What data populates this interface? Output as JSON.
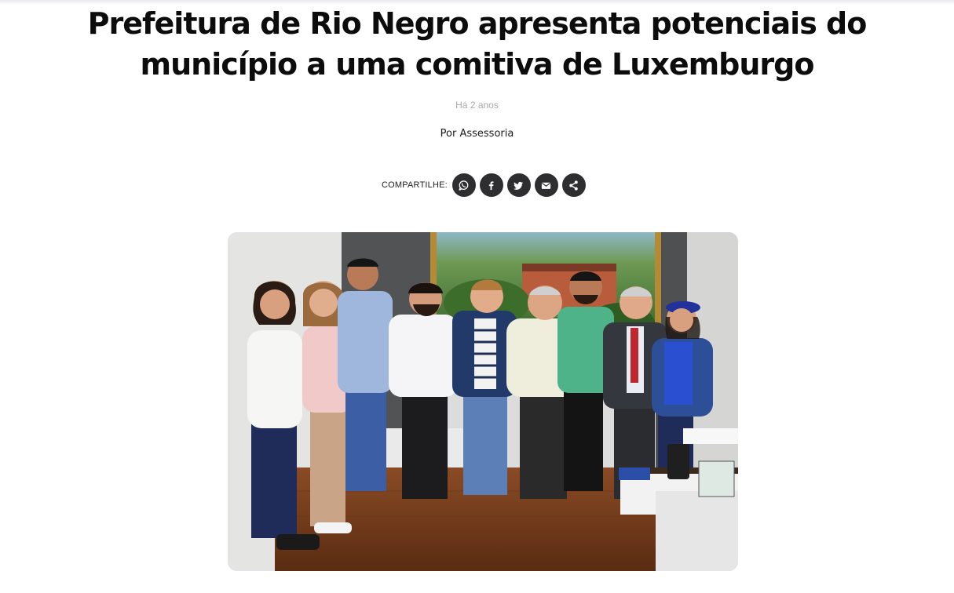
{
  "article": {
    "title": "Prefeitura de Rio Negro apresenta potenciais do município a uma comitiva de Luxemburgo",
    "date": "Há 2 anos",
    "byline": "Por Assessoria"
  },
  "share": {
    "label": "COMPARTILHE:",
    "buttons": [
      {
        "icon": "whatsapp-icon"
      },
      {
        "icon": "facebook-icon"
      },
      {
        "icon": "twitter-icon"
      },
      {
        "icon": "email-icon"
      },
      {
        "icon": "share-icon"
      }
    ]
  },
  "colors": {
    "share_button_bg": "#2e2e30",
    "date_text": "#a8a8ad"
  }
}
